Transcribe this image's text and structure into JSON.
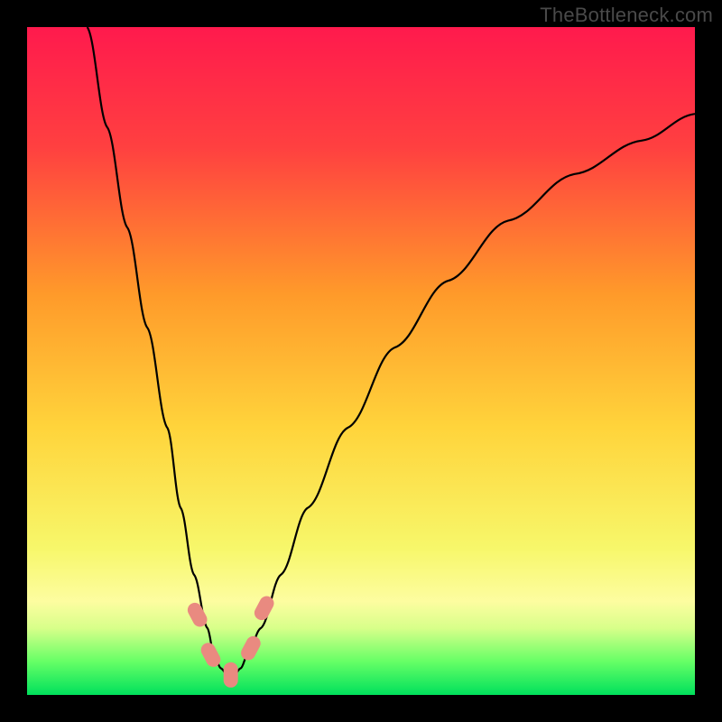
{
  "watermark": "TheBottleneck.com",
  "chart_data": {
    "type": "line",
    "title": "",
    "xlabel": "",
    "ylabel": "",
    "xlim": [
      0,
      100
    ],
    "ylim": [
      0,
      100
    ],
    "gradient_background": {
      "description": "vertical gradient red→orange→yellow→green representing bottleneck severity (high at top, low at bottom)",
      "stops": [
        {
          "pos": 0.0,
          "color": "#ff1a4d"
        },
        {
          "pos": 0.18,
          "color": "#ff4040"
        },
        {
          "pos": 0.4,
          "color": "#ff9a2a"
        },
        {
          "pos": 0.6,
          "color": "#ffd43b"
        },
        {
          "pos": 0.78,
          "color": "#f7f76a"
        },
        {
          "pos": 0.86,
          "color": "#fdfda0"
        },
        {
          "pos": 0.9,
          "color": "#d8ff8a"
        },
        {
          "pos": 0.95,
          "color": "#66ff66"
        },
        {
          "pos": 1.0,
          "color": "#00e05c"
        }
      ]
    },
    "series": [
      {
        "name": "bottleneck-curve",
        "color": "#000000",
        "x": [
          9,
          12,
          15,
          18,
          21,
          23,
          25,
          27,
          28,
          29,
          30,
          31,
          32,
          33,
          35,
          38,
          42,
          48,
          55,
          63,
          72,
          82,
          92,
          100
        ],
        "y": [
          100,
          85,
          70,
          55,
          40,
          28,
          18,
          10,
          6,
          4,
          3,
          3,
          4,
          6,
          10,
          18,
          28,
          40,
          52,
          62,
          71,
          78,
          83,
          87
        ]
      }
    ],
    "markers": [
      {
        "name": "marker-left-1",
        "x": 25.5,
        "y": 12,
        "color": "#e98a80",
        "shape": "rounded-rect"
      },
      {
        "name": "marker-left-2",
        "x": 27.5,
        "y": 6,
        "color": "#e98a80",
        "shape": "rounded-rect"
      },
      {
        "name": "marker-bottom",
        "x": 30.5,
        "y": 3,
        "color": "#e98a80",
        "shape": "rounded-rect"
      },
      {
        "name": "marker-right-1",
        "x": 33.5,
        "y": 7,
        "color": "#e98a80",
        "shape": "rounded-rect"
      },
      {
        "name": "marker-right-2",
        "x": 35.5,
        "y": 13,
        "color": "#e98a80",
        "shape": "rounded-rect"
      }
    ],
    "valley_x_approx": 30
  }
}
